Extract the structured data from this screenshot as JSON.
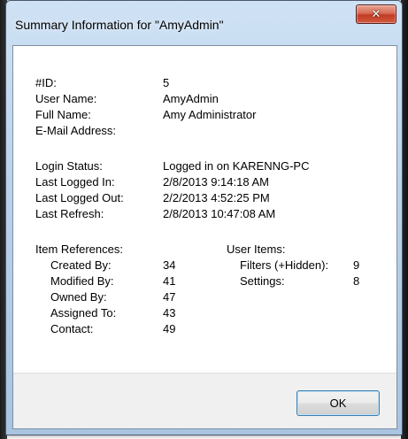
{
  "window": {
    "title": "Summary Information for \"AmyAdmin\"",
    "close_glyph": "✕"
  },
  "user": {
    "id_label": "#ID:",
    "id_value": "5",
    "username_label": "User Name:",
    "username_value": "AmyAdmin",
    "fullname_label": "Full Name:",
    "fullname_value": "Amy Administrator",
    "email_label": "E-Mail Address:",
    "email_value": ""
  },
  "login": {
    "status_label": "Login Status:",
    "status_value": "Logged in on KARENNG-PC",
    "last_in_label": "Last Logged In:",
    "last_in_value": "2/8/2013 9:14:18 AM",
    "last_out_label": "Last Logged Out:",
    "last_out_value": "2/2/2013 4:52:25 PM",
    "last_refresh_label": "Last Refresh:",
    "last_refresh_value": "2/8/2013 10:47:08 AM"
  },
  "item_references": {
    "heading": "Item References:",
    "rows": [
      {
        "label": "Created By:",
        "value": "34"
      },
      {
        "label": "Modified By:",
        "value": "41"
      },
      {
        "label": "Owned By:",
        "value": "47"
      },
      {
        "label": "Assigned To:",
        "value": "43"
      },
      {
        "label": "Contact:",
        "value": "49"
      }
    ]
  },
  "user_items": {
    "heading": "User Items:",
    "rows": [
      {
        "label": "Filters (+Hidden):",
        "value": "9"
      },
      {
        "label": "Settings:",
        "value": "8"
      }
    ]
  },
  "footer": {
    "ok_label": "OK"
  }
}
